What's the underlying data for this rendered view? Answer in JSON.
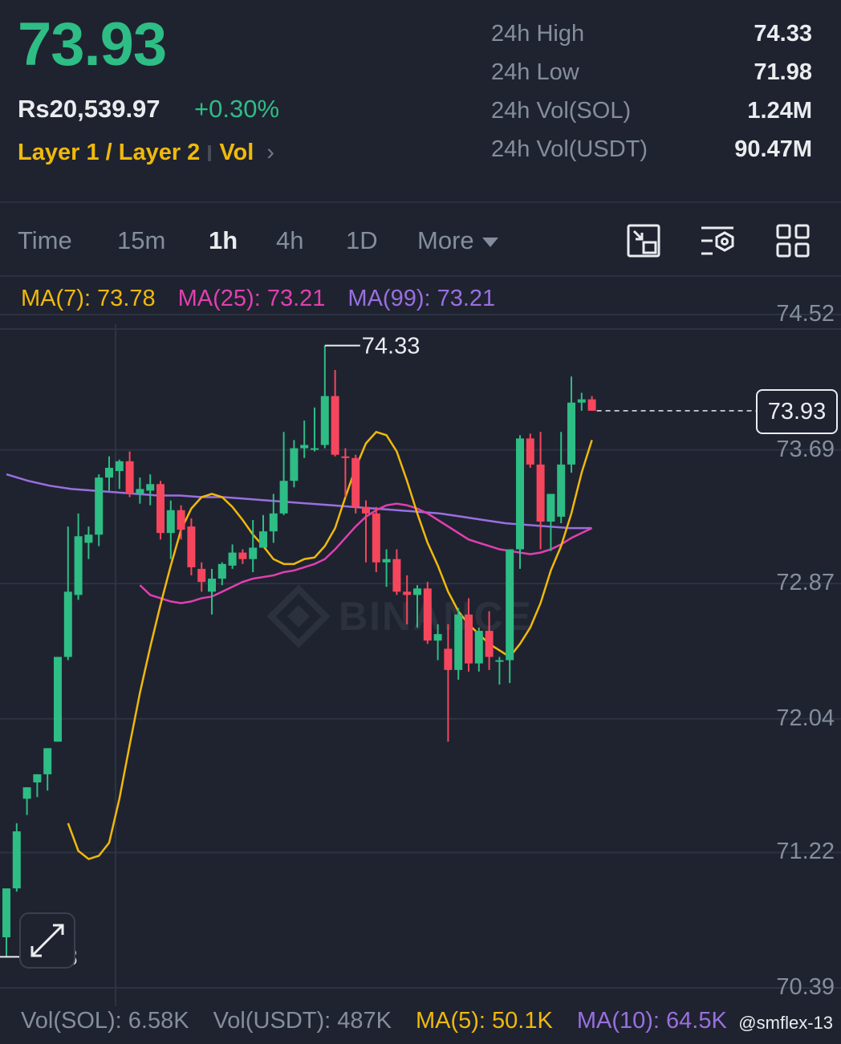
{
  "header": {
    "price": "73.93",
    "fiat_price": "Rs20,539.97",
    "change": "+0.30%",
    "tag1": "Layer 1 / Layer 2",
    "tag2": "Vol",
    "chevron": "›"
  },
  "stats": [
    {
      "label": "24h High",
      "value": "74.33"
    },
    {
      "label": "24h Low",
      "value": "71.98"
    },
    {
      "label": "24h Vol(SOL)",
      "value": "1.24M"
    },
    {
      "label": "24h Vol(USDT)",
      "value": "90.47M"
    }
  ],
  "timeframes": {
    "time": "Time",
    "m15": "15m",
    "h1": "1h",
    "h4": "4h",
    "d1": "1D",
    "more": "More",
    "active": "1h"
  },
  "tools": [
    "chart-type-icon",
    "indicator-settings-icon",
    "layout-grid-icon"
  ],
  "ma_legend": {
    "ma7": "MA(7): 73.78",
    "ma25": "MA(25): 73.21",
    "ma99": "MA(99): 73.21"
  },
  "colors": {
    "up": "#2ebd85",
    "down": "#f6465d",
    "ma7": "#f0b90b",
    "ma25": "#e040b0",
    "ma99": "#9a6fe0",
    "accent": "#f0b90b",
    "background": "#1f2330"
  },
  "chart_data": {
    "type": "candlestick",
    "interval": "1h",
    "y_ticks": [
      "74.52",
      "73.69",
      "72.87",
      "72.04",
      "71.22",
      "70.39"
    ],
    "ylim": [
      70.39,
      74.52
    ],
    "max_label": "74.33",
    "min_label": "70.58",
    "current_price": "73.93",
    "watermark": "BINANCE",
    "candles": [
      {
        "o": 70.7,
        "h": 71.0,
        "l": 70.58,
        "c": 71.0
      },
      {
        "o": 71.0,
        "h": 71.4,
        "l": 70.98,
        "c": 71.35
      },
      {
        "o": 71.55,
        "h": 71.62,
        "l": 71.45,
        "c": 71.62
      },
      {
        "o": 71.65,
        "h": 71.7,
        "l": 71.56,
        "c": 71.7
      },
      {
        "o": 71.7,
        "h": 71.86,
        "l": 71.6,
        "c": 71.86
      },
      {
        "o": 71.9,
        "h": 72.42,
        "l": 71.9,
        "c": 72.42
      },
      {
        "o": 72.42,
        "h": 73.22,
        "l": 72.4,
        "c": 72.82
      },
      {
        "o": 72.8,
        "h": 73.3,
        "l": 72.77,
        "c": 73.16
      },
      {
        "o": 73.12,
        "h": 73.22,
        "l": 73.02,
        "c": 73.17
      },
      {
        "o": 73.17,
        "h": 73.54,
        "l": 73.1,
        "c": 73.52
      },
      {
        "o": 73.52,
        "h": 73.65,
        "l": 73.44,
        "c": 73.58
      },
      {
        "o": 73.56,
        "h": 73.63,
        "l": 73.45,
        "c": 73.62
      },
      {
        "o": 73.62,
        "h": 73.68,
        "l": 73.4,
        "c": 73.42
      },
      {
        "o": 73.42,
        "h": 73.52,
        "l": 73.36,
        "c": 73.45
      },
      {
        "o": 73.44,
        "h": 73.54,
        "l": 73.35,
        "c": 73.48
      },
      {
        "o": 73.48,
        "h": 73.5,
        "l": 73.14,
        "c": 73.18
      },
      {
        "o": 73.18,
        "h": 73.38,
        "l": 73.02,
        "c": 73.32
      },
      {
        "o": 73.32,
        "h": 73.35,
        "l": 73.14,
        "c": 73.2
      },
      {
        "o": 73.22,
        "h": 73.27,
        "l": 72.92,
        "c": 72.97
      },
      {
        "o": 72.96,
        "h": 73.0,
        "l": 72.82,
        "c": 72.88
      },
      {
        "o": 72.82,
        "h": 72.96,
        "l": 72.68,
        "c": 72.9
      },
      {
        "o": 72.9,
        "h": 73.0,
        "l": 72.86,
        "c": 72.99
      },
      {
        "o": 72.98,
        "h": 73.11,
        "l": 72.96,
        "c": 73.06
      },
      {
        "o": 73.06,
        "h": 73.08,
        "l": 72.99,
        "c": 73.02
      },
      {
        "o": 73.02,
        "h": 73.26,
        "l": 72.94,
        "c": 73.09
      },
      {
        "o": 73.09,
        "h": 73.29,
        "l": 73.09,
        "c": 73.19
      },
      {
        "o": 73.19,
        "h": 73.42,
        "l": 73.12,
        "c": 73.3
      },
      {
        "o": 73.3,
        "h": 73.8,
        "l": 73.29,
        "c": 73.5
      },
      {
        "o": 73.5,
        "h": 73.75,
        "l": 73.46,
        "c": 73.7
      },
      {
        "o": 73.7,
        "h": 73.87,
        "l": 73.64,
        "c": 73.72
      },
      {
        "o": 73.7,
        "h": 73.95,
        "l": 73.68,
        "c": 73.7
      },
      {
        "o": 73.72,
        "h": 74.33,
        "l": 73.7,
        "c": 74.02
      },
      {
        "o": 74.02,
        "h": 74.18,
        "l": 73.65,
        "c": 73.66
      },
      {
        "o": 73.65,
        "h": 73.7,
        "l": 73.4,
        "c": 73.64
      },
      {
        "o": 73.64,
        "h": 73.66,
        "l": 73.3,
        "c": 73.34
      },
      {
        "o": 73.34,
        "h": 73.38,
        "l": 73.0,
        "c": 73.3
      },
      {
        "o": 73.3,
        "h": 73.34,
        "l": 72.94,
        "c": 73.0
      },
      {
        "o": 73.0,
        "h": 73.08,
        "l": 72.85,
        "c": 73.02
      },
      {
        "o": 73.02,
        "h": 73.08,
        "l": 72.8,
        "c": 72.82
      },
      {
        "o": 72.82,
        "h": 72.92,
        "l": 72.62,
        "c": 72.8
      },
      {
        "o": 72.8,
        "h": 72.86,
        "l": 72.6,
        "c": 72.84
      },
      {
        "o": 72.84,
        "h": 72.88,
        "l": 72.5,
        "c": 72.52
      },
      {
        "o": 72.52,
        "h": 72.62,
        "l": 72.4,
        "c": 72.56
      },
      {
        "o": 72.47,
        "h": 72.62,
        "l": 71.9,
        "c": 72.34
      },
      {
        "o": 72.34,
        "h": 72.72,
        "l": 72.28,
        "c": 72.68
      },
      {
        "o": 72.68,
        "h": 72.78,
        "l": 72.33,
        "c": 72.38
      },
      {
        "o": 72.38,
        "h": 72.6,
        "l": 72.33,
        "c": 72.58
      },
      {
        "o": 72.58,
        "h": 72.7,
        "l": 72.34,
        "c": 72.42
      },
      {
        "o": 72.4,
        "h": 72.42,
        "l": 72.25,
        "c": 72.4
      },
      {
        "o": 72.4,
        "h": 73.08,
        "l": 72.26,
        "c": 73.08
      },
      {
        "o": 73.08,
        "h": 73.78,
        "l": 72.96,
        "c": 73.76
      },
      {
        "o": 73.76,
        "h": 73.79,
        "l": 73.58,
        "c": 73.6
      },
      {
        "o": 73.6,
        "h": 73.8,
        "l": 73.08,
        "c": 73.25
      },
      {
        "o": 73.25,
        "h": 73.42,
        "l": 73.07,
        "c": 73.42
      },
      {
        "o": 73.28,
        "h": 73.8,
        "l": 73.24,
        "c": 73.6
      },
      {
        "o": 73.6,
        "h": 74.14,
        "l": 73.55,
        "c": 73.98
      },
      {
        "o": 73.98,
        "h": 74.04,
        "l": 73.93,
        "c": 74.0
      },
      {
        "o": 74.0,
        "h": 74.02,
        "l": 73.93,
        "c": 73.93
      }
    ],
    "ma7": [
      71.4,
      71.23,
      71.18,
      71.2,
      71.28,
      71.55,
      71.88,
      72.2,
      72.48,
      72.74,
      72.98,
      73.2,
      73.33,
      73.4,
      73.42,
      73.4,
      73.34,
      73.26,
      73.17,
      73.1,
      73.02,
      72.99,
      72.99,
      73.02,
      73.03,
      73.1,
      73.21,
      73.4,
      73.58,
      73.73,
      73.8,
      73.78,
      73.68,
      73.5,
      73.3,
      73.12,
      72.98,
      72.82,
      72.7,
      72.62,
      72.56,
      72.5,
      72.46,
      72.42,
      72.5,
      72.6,
      72.75,
      72.95,
      73.1,
      73.3,
      73.55,
      73.75
    ],
    "ma25": [
      72.86,
      72.8,
      72.78,
      72.76,
      72.75,
      72.76,
      72.78,
      72.79,
      72.82,
      72.85,
      72.88,
      72.9,
      72.91,
      72.92,
      72.94,
      72.95,
      72.97,
      72.99,
      73.02,
      73.08,
      73.15,
      73.22,
      73.28,
      73.32,
      73.35,
      73.36,
      73.35,
      73.33,
      73.3,
      73.26,
      73.22,
      73.18,
      73.14,
      73.12,
      73.1,
      73.08,
      73.07,
      73.06,
      73.05,
      73.06,
      73.08,
      73.11,
      73.15,
      73.18,
      73.21
    ],
    "ma99": [
      73.54,
      73.5,
      73.47,
      73.45,
      73.44,
      73.43,
      73.42,
      73.41,
      73.41,
      73.4,
      73.4,
      73.39,
      73.38,
      73.37,
      73.36,
      73.35,
      73.34,
      73.33,
      73.32,
      73.31,
      73.3,
      73.28,
      73.26,
      73.24,
      73.23,
      73.22,
      73.21,
      73.21
    ]
  },
  "volume_bar": {
    "vol_sol": "Vol(SOL): 6.58K",
    "vol_usdt": "Vol(USDT): 487K",
    "ma5": "MA(5): 50.1K",
    "ma10": "MA(10): 64.5K"
  },
  "credit": "@smflex-13"
}
